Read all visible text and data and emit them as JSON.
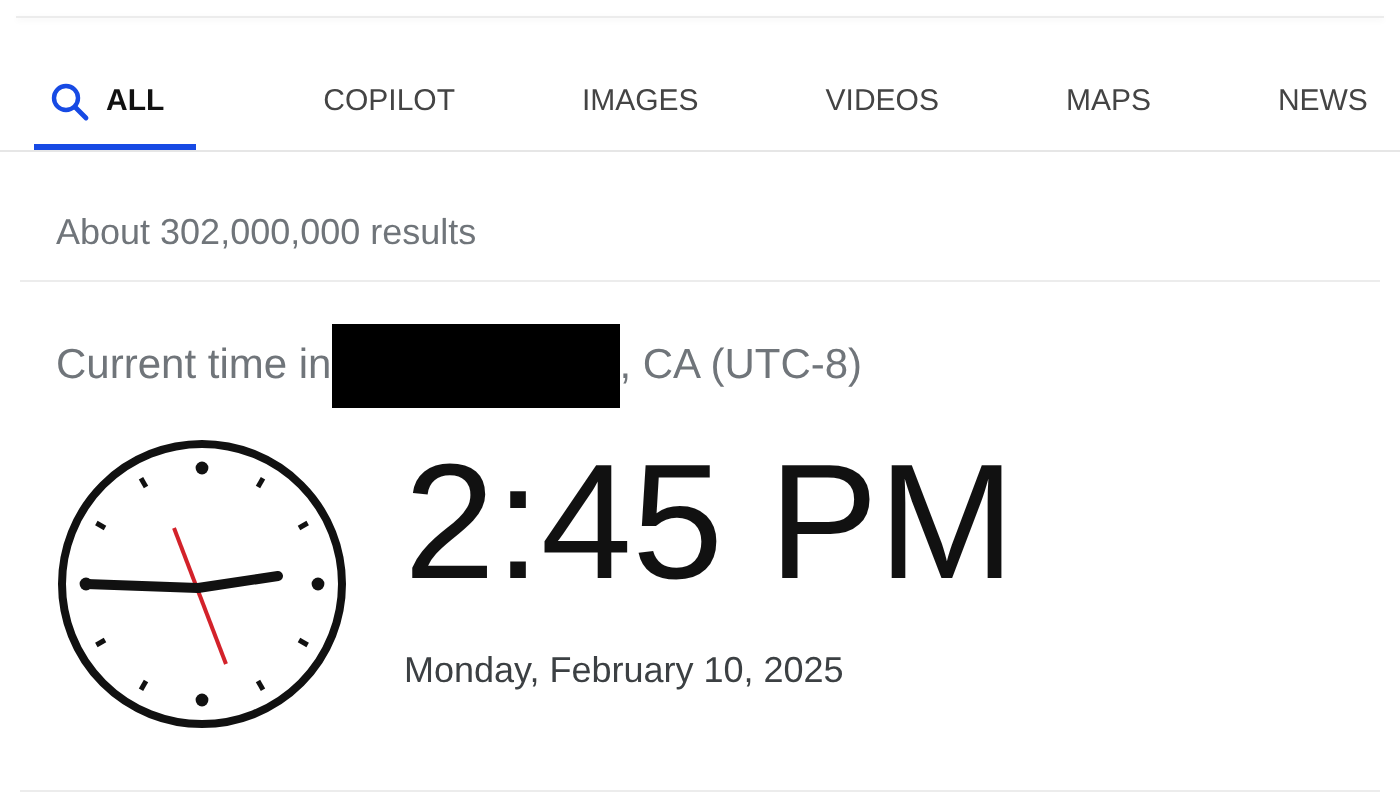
{
  "tabs": [
    {
      "label": "ALL",
      "selected": true,
      "kind": "search"
    },
    {
      "label": "COPILOT",
      "selected": false
    },
    {
      "label": "IMAGES",
      "selected": false
    },
    {
      "label": "VIDEOS",
      "selected": false
    },
    {
      "label": "MAPS",
      "selected": false
    },
    {
      "label": "NEWS",
      "selected": false
    }
  ],
  "results_count": "About 302,000,000 results",
  "time_card": {
    "heading_prefix": "Current time in",
    "redacted": true,
    "heading_suffix": ", CA (UTC-8)",
    "time": "2:45 PM",
    "date": "Monday, February 10, 2025"
  }
}
